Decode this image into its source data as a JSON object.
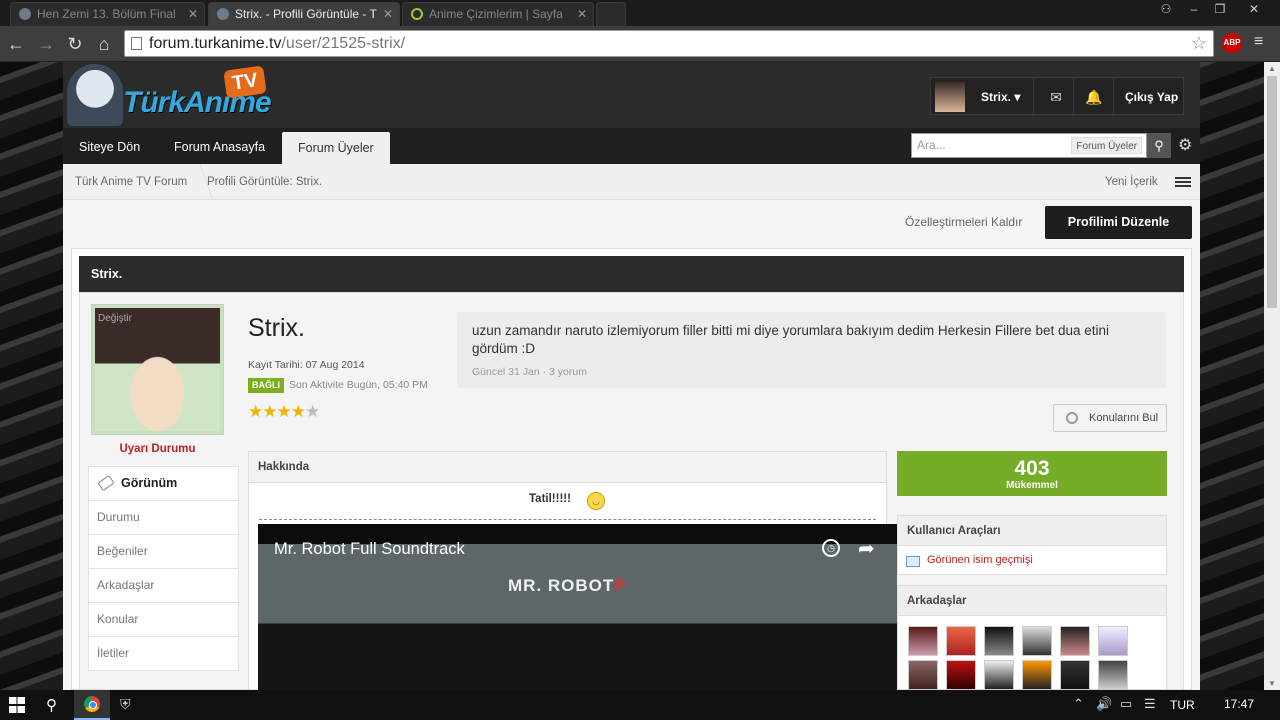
{
  "browser": {
    "tabs": [
      {
        "title": "Hen Zemi 13. Bölüm Final"
      },
      {
        "title": "Strix. - Profili Görüntüle - T"
      },
      {
        "title": "Anime Çizimlerim | Sayfa"
      }
    ],
    "url_host": "forum.turkanime.tv",
    "url_path": "/user/21525-strix/",
    "abp_label": "ABP"
  },
  "site": {
    "logo_text": "TürkAnime",
    "logo_tv": "TV",
    "user_menu": {
      "username": "Strix.",
      "logout": "Çıkış Yap"
    },
    "nav": [
      "Siteye Dön",
      "Forum Anasayfa",
      "Forum Üyeler"
    ],
    "search": {
      "placeholder": "Ara...",
      "scope": "Forum Üyeler"
    },
    "breadcrumbs": [
      "Türk Anime TV Forum",
      "Profili Görüntüle: Strix."
    ],
    "new_content": "Yeni İçerik"
  },
  "actions": {
    "clear_custom": "Özelleştirmeleri Kaldır",
    "edit_profile": "Profilimi Düzenle"
  },
  "profile": {
    "title_bar": "Strix.",
    "avatar_change": "Değiştir",
    "warning": "Uyarı Durumu",
    "name": "Strix.",
    "registered": "Kayıt Tarihi: 07 Aug 2014",
    "online_badge": "BAĞLI",
    "last_activity": "Son Aktivite Bugün, 05:40 PM",
    "rating_stars": 4,
    "rating_max": 5,
    "status_text": "uzun zamandır naruto izlemiyorum filler bitti mi diye yorumlara bakıyım dedim Herkesin Fillere bet dua etini gördüm :D",
    "status_meta": "Güncel 31 Jan · 3 yorum",
    "find_posts": "Konularını Bul",
    "side_nav": [
      "Görünüm",
      "Durumu",
      "Beğeniler",
      "Arkadaşlar",
      "Konular",
      "İletiler"
    ],
    "about_header": "Hakkında",
    "about_text": "Tatil!!!!!",
    "video_title": "Mr. Robot Full Soundtrack",
    "video_brand": "MR. ROBOT",
    "reputation_value": "403",
    "reputation_label": "Mükemmel",
    "tools_header": "Kullanıcı Araçları",
    "tools_link": "Görünen isim geçmişi",
    "friends_header": "Arkadaşlar"
  },
  "taskbar": {
    "lang": "TUR",
    "time": "17:47"
  },
  "colors": {
    "accent_green": "#75ac28",
    "link_red": "#bb2222",
    "dark": "#2b2b2b"
  }
}
